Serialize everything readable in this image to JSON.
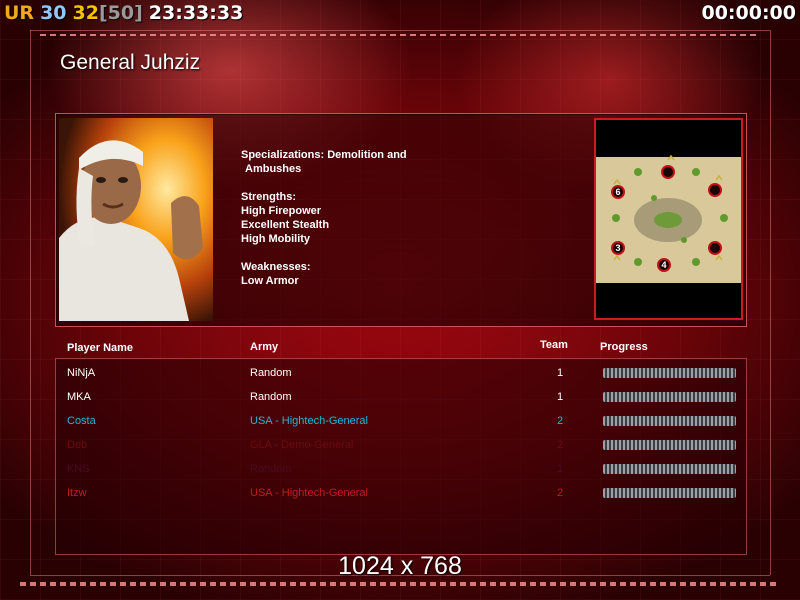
{
  "hud": {
    "label": "UR",
    "fps": "30",
    "fps2": "32",
    "fps_limit": "[50]",
    "clock": "23:33:33",
    "timer": "00:00:00"
  },
  "colors": {
    "hud_label": "#f2a81c",
    "hud_fps": "#8ec8ff",
    "hud_fps2": "#f5c400",
    "hud_limit": "#9a9a9a",
    "white": "#ffffff",
    "team_cyan": "#27b4d6",
    "dark_red": "#b0181e",
    "very_dark_red": "#5a0a10"
  },
  "general": {
    "title": "General Juhziz",
    "specializations_label": "Specializations: Demolition and",
    "specializations_cont": "Ambushes",
    "strengths_label": "Strengths:",
    "strengths": [
      "High Firepower",
      "Excellent Stealth",
      "High Mobility"
    ],
    "weaknesses_label": "Weaknesses:",
    "weaknesses": [
      "Low Armor"
    ],
    "portrait_icon": "general-portrait"
  },
  "minimap": {
    "slots": [
      "6",
      "3",
      "4"
    ]
  },
  "table": {
    "headers": {
      "player_name": "Player Name",
      "army": "Army",
      "team": "Team",
      "progress": "Progress"
    },
    "rows": [
      {
        "name": "NiNjA",
        "army": "Random",
        "team": "1",
        "color": "#ffffff",
        "progress": 1.0
      },
      {
        "name": "MKA",
        "army": "Random",
        "team": "1",
        "color": "#ffffff",
        "progress": 1.0
      },
      {
        "name": "Costa",
        "army": "USA - Hightech-General",
        "team": "2",
        "color": "#27b4d6",
        "progress": 1.0
      },
      {
        "name": "Deb",
        "army": "GLA - Demo-General",
        "team": "2",
        "color": "#6a0c12",
        "progress": 1.0
      },
      {
        "name": "KNS",
        "army": "Random",
        "team": "1",
        "color": "#4a0a22",
        "progress": 1.0
      },
      {
        "name": "Itzw",
        "army": "USA - Hightech-General",
        "team": "2",
        "color": "#c41b20",
        "progress": 1.0
      }
    ]
  },
  "resolution_text": "1024 x 768"
}
